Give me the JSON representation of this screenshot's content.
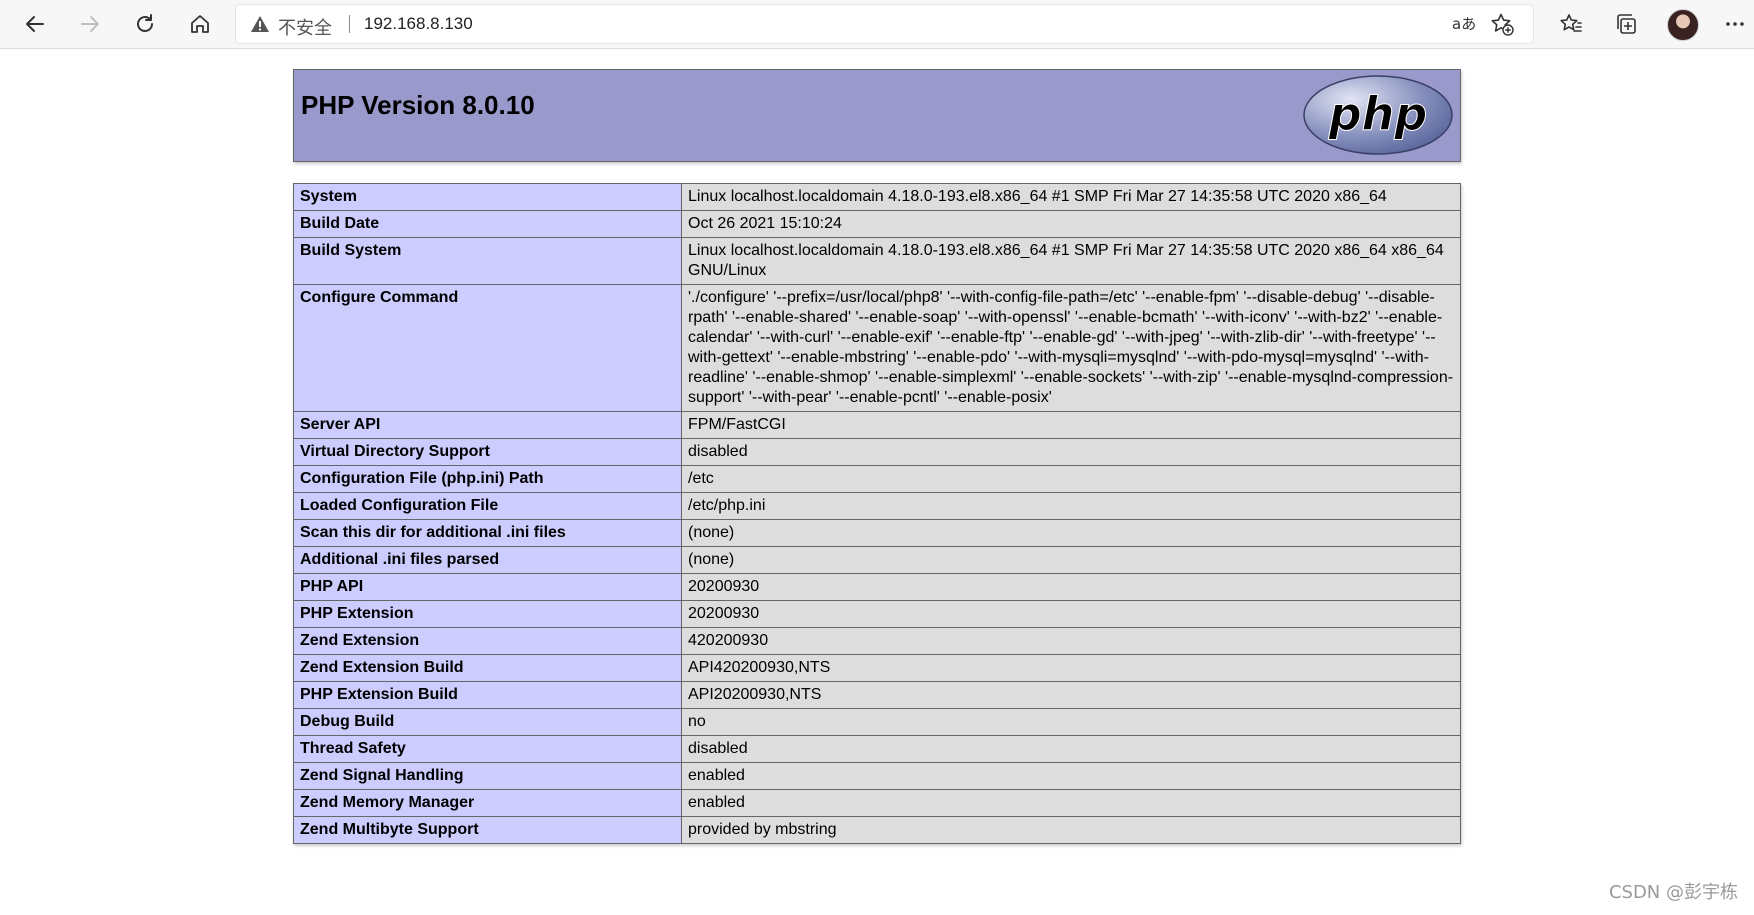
{
  "browser": {
    "insecure_label": "不安全",
    "url": "192.168.8.130",
    "read_aloud_label": "aあ"
  },
  "page": {
    "title": "PHP Version 8.0.10",
    "logo_text": "php",
    "rows": [
      {
        "key": "System",
        "value": "Linux localhost.localdomain 4.18.0-193.el8.x86_64 #1 SMP Fri Mar 27 14:35:58 UTC 2020 x86_64"
      },
      {
        "key": "Build Date",
        "value": "Oct 26 2021 15:10:24"
      },
      {
        "key": "Build System",
        "value": "Linux localhost.localdomain 4.18.0-193.el8.x86_64 #1 SMP Fri Mar 27 14:35:58 UTC 2020 x86_64 x86_64 GNU/Linux"
      },
      {
        "key": "Configure Command",
        "value": "'./configure' '--prefix=/usr/local/php8' '--with-config-file-path=/etc' '--enable-fpm' '--disable-debug' '--disable-rpath' '--enable-shared' '--enable-soap' '--with-openssl' '--enable-bcmath' '--with-iconv' '--with-bz2' '--enable-calendar' '--with-curl' '--enable-exif' '--enable-ftp' '--enable-gd' '--with-jpeg' '--with-zlib-dir' '--with-freetype' '--with-gettext' '--enable-mbstring' '--enable-pdo' '--with-mysqli=mysqlnd' '--with-pdo-mysql=mysqlnd' '--with-readline' '--enable-shmop' '--enable-simplexml' '--enable-sockets' '--with-zip' '--enable-mysqlnd-compression-support' '--with-pear' '--enable-pcntl' '--enable-posix'"
      },
      {
        "key": "Server API",
        "value": "FPM/FastCGI"
      },
      {
        "key": "Virtual Directory Support",
        "value": "disabled"
      },
      {
        "key": "Configuration File (php.ini) Path",
        "value": "/etc"
      },
      {
        "key": "Loaded Configuration File",
        "value": "/etc/php.ini"
      },
      {
        "key": "Scan this dir for additional .ini files",
        "value": "(none)"
      },
      {
        "key": "Additional .ini files parsed",
        "value": "(none)"
      },
      {
        "key": "PHP API",
        "value": "20200930"
      },
      {
        "key": "PHP Extension",
        "value": "20200930"
      },
      {
        "key": "Zend Extension",
        "value": "420200930"
      },
      {
        "key": "Zend Extension Build",
        "value": "API420200930,NTS"
      },
      {
        "key": "PHP Extension Build",
        "value": "API20200930,NTS"
      },
      {
        "key": "Debug Build",
        "value": "no"
      },
      {
        "key": "Thread Safety",
        "value": "disabled"
      },
      {
        "key": "Zend Signal Handling",
        "value": "enabled"
      },
      {
        "key": "Zend Memory Manager",
        "value": "enabled"
      },
      {
        "key": "Zend Multibyte Support",
        "value": "provided by mbstring"
      }
    ]
  },
  "watermark": "CSDN @彭宇栋"
}
